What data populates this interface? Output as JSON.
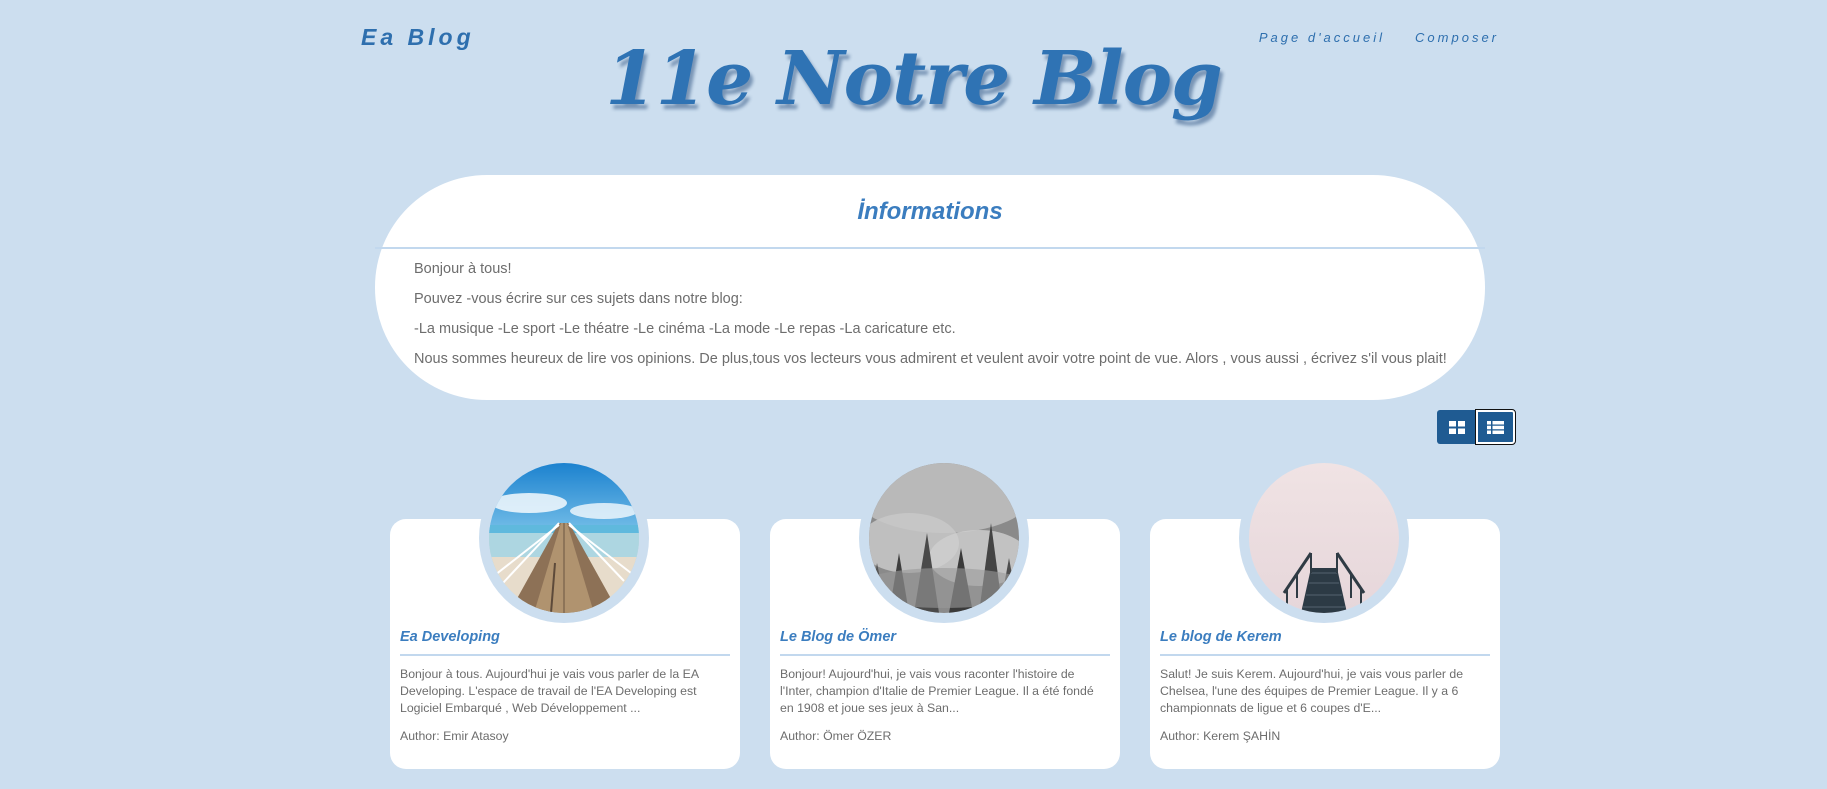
{
  "header": {
    "brand": "Ea Blog",
    "nav": [
      "Page d'accueil",
      "Composer"
    ],
    "hero_title": "11e Notre Blog"
  },
  "info": {
    "title": "İnformations",
    "paragraphs": [
      "Bonjour à tous!",
      "Pouvez -vous écrire sur ces sujets dans notre blog:",
      "-La musique -Le sport -Le théatre -Le cinéma -La mode -Le repas -La caricature etc.",
      "Nous sommes heureux de lire vos opinions. De plus,tous vos lecteurs vous admirent et veulent avoir votre point de vue. Alors , vous aussi , écrivez s'il vous plait!"
    ]
  },
  "view_toggle": {
    "icons": [
      "grid-view-icon",
      "list-view-icon"
    ],
    "active": "list"
  },
  "posts": [
    {
      "title": "Ea Developing",
      "excerpt": "Bonjour à tous. Aujourd'hui je vais vous parler de la EA Developing. L'espace de travail de l'EA Developing est Logiciel Embarqué , Web Développement ...",
      "author": "Author: Emir Atasoy",
      "image": "pier-photo"
    },
    {
      "title": "Le Blog de Ömer",
      "excerpt": "Bonjour! Aujourd'hui, je vais vous raconter l'histoire de l'Inter, champion d'Italie de Premier League. Il a été fondé en 1908 et joue ses jeux à San...",
      "author": "Author: Ömer ÖZER",
      "image": "misty-forest-photo"
    },
    {
      "title": "Le blog de Kerem",
      "excerpt": "Salut! Je suis Kerem. Aujourd'hui, je vais vous parler de Chelsea, l'une des équipes de Premier League. Il y a 6 championnats de ligue et 6 coupes d'E...",
      "author": "Author: Kerem ŞAHİN",
      "image": "foggy-stairs-photo"
    }
  ],
  "colors": {
    "background": "#ccdeef",
    "accent": "#2e6fae",
    "button": "#1f5b92"
  }
}
